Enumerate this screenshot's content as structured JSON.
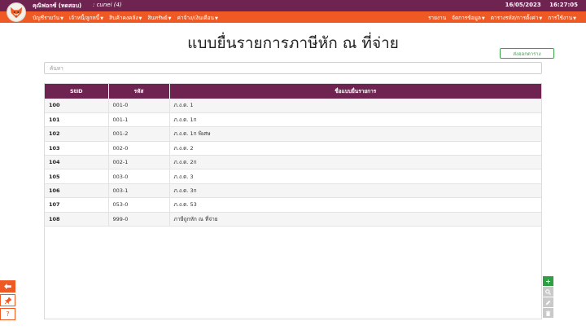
{
  "header": {
    "brand": "คุณิฟอกซ์ (ทดสอบ)",
    "user": ": cunei  (4)",
    "date": "16/05/2023",
    "time": "16:27:05"
  },
  "menu": {
    "left": [
      {
        "label": "บัญชีรายวัน"
      },
      {
        "label": "เจ้าหนี้/ลูกหนี้"
      },
      {
        "label": "สินค้าคงคลัง"
      },
      {
        "label": "สินทรัพย์"
      },
      {
        "label": "ค่าจ้าง/เงินเดือน"
      }
    ],
    "right": [
      {
        "label": "รายงาน",
        "caret": false
      },
      {
        "label": "จัดการข้อมูล",
        "caret": true
      },
      {
        "label": "ตารางรหัส/การตั้งค่า",
        "caret": true
      },
      {
        "label": "การใช้งาน",
        "caret": true
      }
    ]
  },
  "page": {
    "title": "แบบยื่นรายการภาษีหัก ณ ที่จ่าย",
    "export_label": "ส่งออกตาราง",
    "search_placeholder": "ค้นหา"
  },
  "table": {
    "columns": [
      "StID",
      "รหัส",
      "ชื่อแบบยื่นรายการ"
    ],
    "rows": [
      {
        "stid": "100",
        "code": "001-0",
        "name": "ภ.ง.ด. 1"
      },
      {
        "stid": "101",
        "code": "001-1",
        "name": "ภ.ง.ด. 1ก"
      },
      {
        "stid": "102",
        "code": "001-2",
        "name": "ภ.ง.ด. 1ก พิเศษ"
      },
      {
        "stid": "103",
        "code": "002-0",
        "name": "ภ.ง.ด. 2"
      },
      {
        "stid": "104",
        "code": "002-1",
        "name": "ภ.ง.ด. 2ก"
      },
      {
        "stid": "105",
        "code": "003-0",
        "name": "ภ.ง.ด. 3"
      },
      {
        "stid": "106",
        "code": "003-1",
        "name": "ภ.ง.ด. 3ก"
      },
      {
        "stid": "107",
        "code": "053-0",
        "name": "ภ.ง.ด. 53"
      },
      {
        "stid": "108",
        "code": "999-0",
        "name": "ภาษีถูกหัก ณ ที่จ่าย"
      }
    ]
  },
  "icons": {
    "logo": "fox-logo-icon",
    "back": "arrow-left-icon",
    "pin": "pin-icon",
    "help": "question-icon",
    "add": "plus-icon",
    "view": "search-icon",
    "edit": "pencil-icon",
    "delete": "trash-icon"
  },
  "colors": {
    "primary": "#6e2350",
    "accent": "#ef5a24",
    "success": "#3aa14a"
  }
}
